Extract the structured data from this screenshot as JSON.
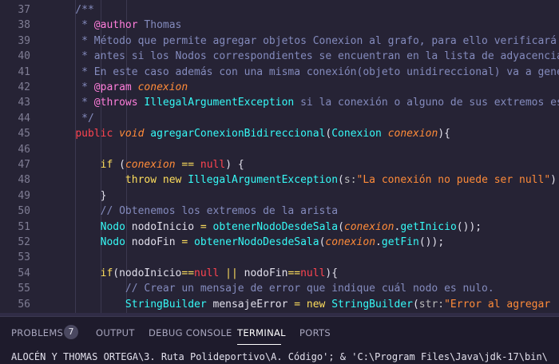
{
  "editor": {
    "lines": [
      {
        "n": "37",
        "tokens": [
          [
            "cm",
            "    /**"
          ]
        ]
      },
      {
        "n": "38",
        "tokens": [
          [
            "cm",
            "     * "
          ],
          [
            "tag",
            "@author"
          ],
          [
            "cm",
            " Thomas"
          ]
        ]
      },
      {
        "n": "39",
        "tokens": [
          [
            "cm",
            "     * Método que permite agregar objetos Conexion al grafo, para ello verificará"
          ]
        ]
      },
      {
        "n": "40",
        "tokens": [
          [
            "cm",
            "     * antes si los Nodos correspondientes se encuentran en la lista de adyacencia"
          ]
        ]
      },
      {
        "n": "41",
        "tokens": [
          [
            "cm",
            "     * En este caso además con una misma conexión(objeto unidireccional) va a gene"
          ]
        ]
      },
      {
        "n": "42",
        "tokens": [
          [
            "cm",
            "     * "
          ],
          [
            "tag",
            "@param"
          ],
          [
            "par",
            " conexion"
          ]
        ]
      },
      {
        "n": "43",
        "tokens": [
          [
            "cm",
            "     * "
          ],
          [
            "tag",
            "@throws"
          ],
          [
            "fn",
            " IllegalArgumentException"
          ],
          [
            "cm",
            " si la conexión o alguno de sus extremos es"
          ]
        ]
      },
      {
        "n": "44",
        "tokens": [
          [
            "cm",
            "     */"
          ]
        ]
      },
      {
        "n": "45",
        "tokens": [
          [
            "vr",
            "    "
          ],
          [
            "kw2",
            "public"
          ],
          [
            "vr",
            " "
          ],
          [
            "par",
            "void"
          ],
          [
            "vr",
            " "
          ],
          [
            "fn",
            "agregarConexionBidireccional"
          ],
          [
            "vr",
            "("
          ],
          [
            "fn",
            "Conexion"
          ],
          [
            "vr",
            " "
          ],
          [
            "par",
            "conexion"
          ],
          [
            "vr",
            "){"
          ]
        ]
      },
      {
        "n": "46",
        "tokens": [
          [
            "vr",
            ""
          ]
        ]
      },
      {
        "n": "47",
        "tokens": [
          [
            "vr",
            "        "
          ],
          [
            "kw",
            "if"
          ],
          [
            "vr",
            " ("
          ],
          [
            "par",
            "conexion"
          ],
          [
            "vr",
            " "
          ],
          [
            "op",
            "=="
          ],
          [
            "vr",
            " "
          ],
          [
            "red",
            "null"
          ],
          [
            "vr",
            ") {"
          ]
        ]
      },
      {
        "n": "48",
        "tokens": [
          [
            "vr",
            "            "
          ],
          [
            "kw",
            "throw"
          ],
          [
            "vr",
            " "
          ],
          [
            "kw",
            "new"
          ],
          [
            "vr",
            " "
          ],
          [
            "fn",
            "IllegalArgumentException"
          ],
          [
            "vr",
            "("
          ],
          [
            "hint",
            "s:"
          ],
          [
            "str",
            "\"La conexión no puede ser null\""
          ],
          [
            "vr",
            ")"
          ]
        ]
      },
      {
        "n": "49",
        "tokens": [
          [
            "vr",
            "        }"
          ]
        ]
      },
      {
        "n": "50",
        "tokens": [
          [
            "cm",
            "        // Obtenemos los extremos de la arista"
          ]
        ]
      },
      {
        "n": "51",
        "tokens": [
          [
            "vr",
            "        "
          ],
          [
            "fn",
            "Nodo"
          ],
          [
            "vr",
            " nodoInicio "
          ],
          [
            "op",
            "="
          ],
          [
            "vr",
            " "
          ],
          [
            "fn",
            "obtenerNodoDesdeSala"
          ],
          [
            "vr",
            "("
          ],
          [
            "par",
            "conexion"
          ],
          [
            "vr",
            "."
          ],
          [
            "fn",
            "getInicio"
          ],
          [
            "vr",
            "());"
          ]
        ]
      },
      {
        "n": "52",
        "tokens": [
          [
            "vr",
            "        "
          ],
          [
            "fn",
            "Nodo"
          ],
          [
            "vr",
            " nodoFin "
          ],
          [
            "op",
            "="
          ],
          [
            "vr",
            " "
          ],
          [
            "fn",
            "obtenerNodoDesdeSala"
          ],
          [
            "vr",
            "("
          ],
          [
            "par",
            "conexion"
          ],
          [
            "vr",
            "."
          ],
          [
            "fn",
            "getFin"
          ],
          [
            "vr",
            "());"
          ]
        ]
      },
      {
        "n": "53",
        "tokens": [
          [
            "vr",
            ""
          ]
        ]
      },
      {
        "n": "54",
        "tokens": [
          [
            "vr",
            "        "
          ],
          [
            "kw",
            "if"
          ],
          [
            "vr",
            "(nodoInicio"
          ],
          [
            "op",
            "=="
          ],
          [
            "red",
            "null"
          ],
          [
            "vr",
            " "
          ],
          [
            "op",
            "||"
          ],
          [
            "vr",
            " nodoFin"
          ],
          [
            "op",
            "=="
          ],
          [
            "red",
            "null"
          ],
          [
            "vr",
            "){"
          ]
        ]
      },
      {
        "n": "55",
        "tokens": [
          [
            "cm",
            "            // Crear un mensaje de error que indique cuál nodo es nulo."
          ]
        ]
      },
      {
        "n": "56",
        "tokens": [
          [
            "vr",
            "            "
          ],
          [
            "fn",
            "StringBuilder"
          ],
          [
            "vr",
            " mensajeError "
          ],
          [
            "op",
            "="
          ],
          [
            "vr",
            " "
          ],
          [
            "kw",
            "new"
          ],
          [
            "vr",
            " "
          ],
          [
            "fn",
            "StringBuilder"
          ],
          [
            "vr",
            "("
          ],
          [
            "hint",
            "str:"
          ],
          [
            "str",
            "\"Error al agregar "
          ]
        ]
      }
    ]
  },
  "panel": {
    "tabs": [
      {
        "label": "PROBLEMS",
        "name": "tab-problems"
      },
      {
        "label": "OUTPUT",
        "name": "tab-output"
      },
      {
        "label": "DEBUG CONSOLE",
        "name": "tab-debug-console"
      },
      {
        "label": "TERMINAL",
        "name": "tab-terminal"
      },
      {
        "label": "PORTS",
        "name": "tab-ports"
      }
    ],
    "problems_count": "7",
    "terminal_line": "ALOCÉN Y THOMAS ORTEGA\\3. Ruta Polideportivo\\A. Código'; & 'C:\\Program Files\\Java\\jdk-17\\bin\\"
  }
}
